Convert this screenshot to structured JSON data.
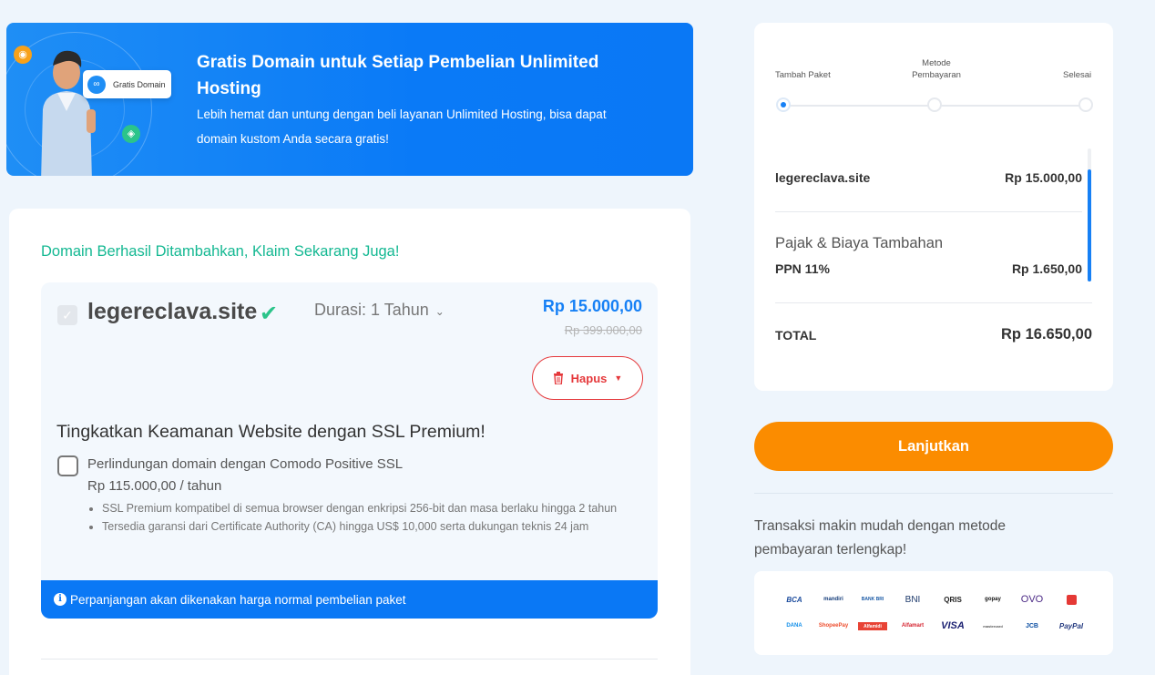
{
  "banner": {
    "chip_label": "Gratis Domain",
    "title": "Gratis Domain untuk Setiap Pembelian Unlimited Hosting",
    "subtitle": "Lebih hemat dan untung dengan beli layanan Unlimited Hosting, bisa dapat domain kustom Anda secara gratis!"
  },
  "cart": {
    "success_message": "Domain Berhasil Ditambahkan, Klaim Sekarang Juga!",
    "domain": {
      "name": "legereclava.site",
      "duration": "Durasi: 1 Tahun",
      "price": "Rp 15.000,00",
      "original_price": "Rp 399.000,00",
      "remove_label": "Hapus"
    },
    "ssl": {
      "title": "Tingkatkan Keamanan Website dengan SSL Premium!",
      "option_label": "Perlindungan domain dengan Comodo Positive SSL",
      "option_price": "Rp 115.000,00 / tahun",
      "features": [
        "SSL Premium kompatibel di semua browser dengan enkripsi 256-bit dan masa berlaku hingga 2 tahun",
        "Tersedia garansi dari Certificate Authority (CA) hingga US$ 10,000 serta dukungan teknis 24 jam"
      ]
    },
    "info_notice": "Perpanjangan akan dikenakan harga normal pembelian paket"
  },
  "summary": {
    "steps": [
      {
        "label": "Tambah Paket",
        "active": true
      },
      {
        "label": "Metode Pembayaran",
        "active": false
      },
      {
        "label": "Selesai",
        "active": false
      }
    ],
    "item_name": "legereclava.site",
    "item_price": "Rp 15.000,00",
    "tax_title": "Pajak & Biaya Tambahan",
    "tax_label": "PPN 11%",
    "tax_amount": "Rp 1.650,00",
    "total_label": "TOTAL",
    "total_amount": "Rp 16.650,00"
  },
  "continue_label": "Lanjutkan",
  "payment": {
    "text": "Transaksi makin mudah dengan metode pembayaran terlengkap!",
    "methods": [
      "BCA",
      "mandiri",
      "BANK BRI",
      "BNI",
      "QRIS",
      "gopay",
      "OVO",
      "Indomaret",
      "DANA",
      "ShopeePay",
      "Alfamidi",
      "Alfamart",
      "VISA",
      "mastercard",
      "JCB",
      "PayPal"
    ]
  },
  "colors": {
    "primary": "#0a78f5",
    "accent_green": "#14b892",
    "danger": "#e5383b",
    "cta": "#fb8c00"
  }
}
